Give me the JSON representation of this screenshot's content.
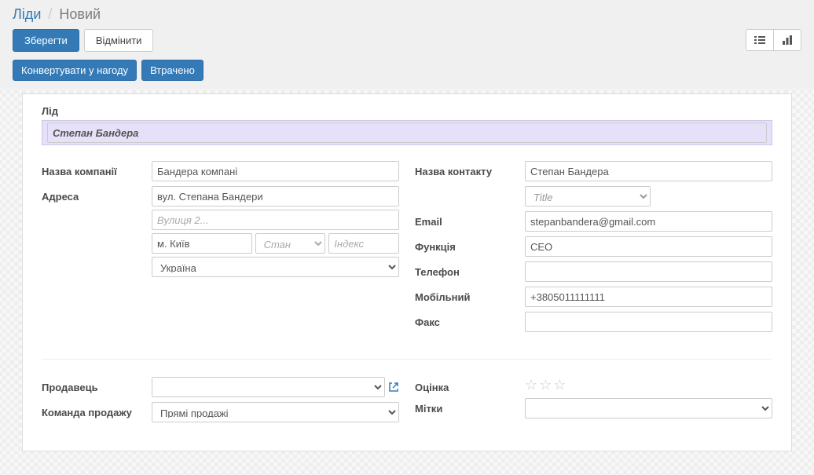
{
  "breadcrumb": {
    "parent": "Ліди",
    "current": "Новий"
  },
  "toolbar": {
    "save": "Зберегти",
    "discard": "Відмінити"
  },
  "statusbar": {
    "convert": "Конвертувати у нагоду",
    "lost": "Втрачено"
  },
  "viewIcons": {
    "list": "list-icon",
    "chart": "bar-chart-icon"
  },
  "lead": {
    "label": "Лід",
    "name": "Степан Бандера"
  },
  "left": {
    "company_label": "Назва компанії",
    "company": "Бандера компані",
    "address_label": "Адреса",
    "street1": "вул. Степана Бандери",
    "street2_ph": "Вулиця 2...",
    "city": "м. Київ",
    "state_ph": "Стан",
    "zip_ph": "Індекс",
    "country": "Україна",
    "seller_label": "Продавець",
    "seller": "",
    "team_label": "Команда продажу",
    "team": "Прямі продажі"
  },
  "right": {
    "contact_label": "Назва контакту",
    "contact": "Степан Бандера",
    "title_ph": "Title",
    "email_label": "Email",
    "email": "stepanbandera@gmail.com",
    "function_label": "Функція",
    "function": "CEO",
    "phone_label": "Телефон",
    "phone": "",
    "mobile_label": "Мобільний",
    "mobile": "+3805011111111",
    "fax_label": "Факс",
    "fax": "",
    "rating_label": "Оцінка",
    "tags_label": "Мітки",
    "tags": ""
  }
}
